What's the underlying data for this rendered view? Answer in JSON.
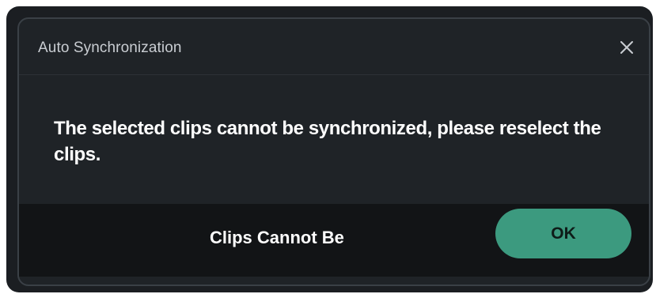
{
  "dialog": {
    "title": "Auto Synchronization",
    "message": "The selected clips cannot be synchronized, please reselect the clips.",
    "close_icon": "close-icon",
    "ok_label": "OK"
  },
  "footer": {
    "caption": "Clips Cannot Be"
  },
  "colors": {
    "dialog_background": "#1f2327",
    "footer_background": "#121416",
    "ok_button": "#3c9a7f",
    "title_text": "#c9cdd2",
    "message_text": "#ffffff"
  }
}
